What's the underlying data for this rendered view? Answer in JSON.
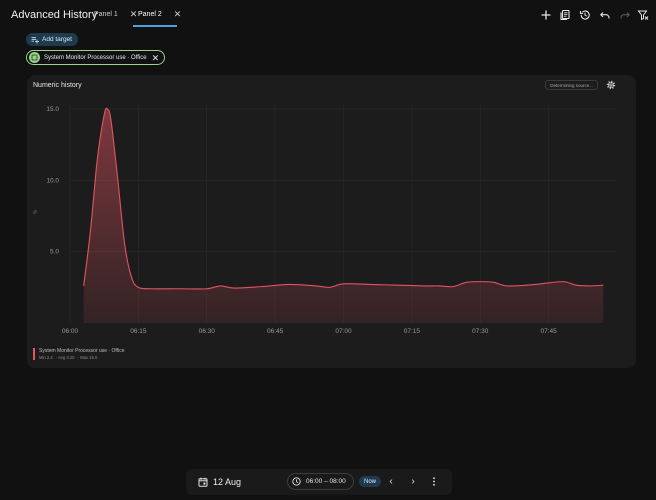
{
  "header": {
    "title": "Advanced History",
    "tabs": [
      {
        "label": "Panel 1",
        "active": false
      },
      {
        "label": "Panel 2",
        "active": true
      }
    ],
    "close_glyph": "✕",
    "actions": [
      "add-icon",
      "copy-icon",
      "history-icon",
      "undo-icon",
      "redo-icon",
      "filter-clear-icon"
    ]
  },
  "targets": {
    "add_label": "Add target",
    "chip_label": "System Monitor Processor use · Office",
    "chip_close": "✕",
    "chip_color": "#9ad28c"
  },
  "card": {
    "title": "Numeric history",
    "source_status": "Determining source..."
  },
  "legend": {
    "name": "System Monitor Processor use · Office",
    "min": "Min 2.4",
    "avg": "Avg 3.20",
    "max": "Max 15.0",
    "color": "#e05561"
  },
  "chart_data": {
    "type": "area",
    "ylabel": "%",
    "ylim": [
      0,
      15
    ],
    "yticks": [
      {
        "value": 5,
        "label": "5.0"
      },
      {
        "value": 10,
        "label": "10.0"
      },
      {
        "value": 15,
        "label": "15.0"
      }
    ],
    "xlim": [
      0,
      120
    ],
    "xticks": [
      {
        "value": 0,
        "label": "06:00"
      },
      {
        "value": 15,
        "label": "06:15"
      },
      {
        "value": 30,
        "label": "06:30"
      },
      {
        "value": 45,
        "label": "06:45"
      },
      {
        "value": 60,
        "label": "07:00"
      },
      {
        "value": 75,
        "label": "07:15"
      },
      {
        "value": 90,
        "label": "07:30"
      },
      {
        "value": 105,
        "label": "07:45"
      }
    ],
    "series": [
      {
        "name": "System Monitor Processor use · Office",
        "color": "#e05561",
        "points": [
          [
            3,
            2.6
          ],
          [
            4.5,
            6.5
          ],
          [
            6,
            11.5
          ],
          [
            7.5,
            14.6
          ],
          [
            8.2,
            15.0
          ],
          [
            9,
            14.2
          ],
          [
            10.5,
            10.0
          ],
          [
            12,
            5.5
          ],
          [
            13.5,
            3.2
          ],
          [
            15,
            2.5
          ],
          [
            18,
            2.4
          ],
          [
            24,
            2.4
          ],
          [
            30,
            2.4
          ],
          [
            33,
            2.6
          ],
          [
            36,
            2.45
          ],
          [
            42,
            2.55
          ],
          [
            48,
            2.7
          ],
          [
            54,
            2.6
          ],
          [
            57,
            2.5
          ],
          [
            60,
            2.75
          ],
          [
            66,
            2.7
          ],
          [
            72,
            2.65
          ],
          [
            78,
            2.6
          ],
          [
            81,
            2.6
          ],
          [
            84,
            2.55
          ],
          [
            87,
            2.85
          ],
          [
            90,
            2.9
          ],
          [
            93,
            2.85
          ],
          [
            96,
            2.6
          ],
          [
            102,
            2.7
          ],
          [
            108,
            2.9
          ],
          [
            111,
            2.65
          ],
          [
            114,
            2.6
          ],
          [
            117,
            2.65
          ]
        ]
      }
    ],
    "grid": true
  },
  "footer": {
    "date": "12 Aug",
    "time_range": "06:00 – 08:00",
    "now_label": "Now",
    "prev_glyph": "‹",
    "next_glyph": "›"
  }
}
